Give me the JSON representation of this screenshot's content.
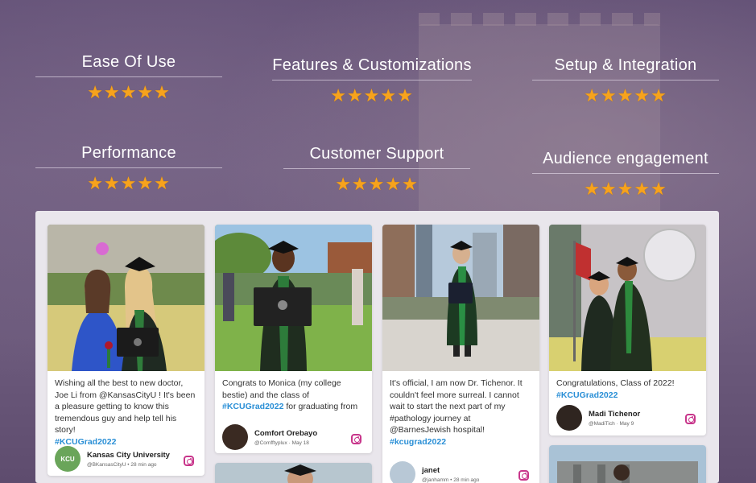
{
  "ratings": [
    {
      "title": "Ease Of Use",
      "stars": "★★★★★"
    },
    {
      "title": "Features & Customizations",
      "stars": "★★★★★"
    },
    {
      "title": "Setup & Integration",
      "stars": "★★★★★"
    },
    {
      "title": "Performance",
      "stars": "★★★★★"
    },
    {
      "title": "Customer Support",
      "stars": "★★★★★"
    },
    {
      "title": "Audience engagement",
      "stars": "★★★★★"
    }
  ],
  "colors": {
    "star": "#f7a31c",
    "hashtag": "#2a8fd6",
    "instagram": "#c8368b"
  },
  "posts": [
    {
      "text": "Wishing all the best to new doctor, Joe Li from @KansasCityU ! It's been a pleasure getting to know this tremendous guy and help tell his story!",
      "hashtag": "#KCUGrad2022",
      "author": "Kansas City University",
      "meta": "@BKansasCityU • 28 min ago",
      "avatar_text": "KCU",
      "icon": "instagram-icon"
    },
    {
      "text": "Congrats to Monica (my college bestie) and the class of",
      "hashtag": "#KCUGrad2022",
      "text_after": " for graduating from",
      "author": "Comfort Orebayo",
      "meta": "@Comfftyplux · May 18",
      "icon": "instagram-icon"
    },
    {
      "text": "It's official, I am now Dr. Tichenor. It couldn't feel more surreal. I cannot wait to start the next part of my #pathology journey at @BarnesJewish hospital!",
      "hashtag": "#kcugrad2022",
      "author": "janet",
      "meta": "@janhamm • 28 min ago",
      "icon": "instagram-icon"
    },
    {
      "text": "Congratulations, Class of 2022!",
      "hashtag": "#KCUGrad2022",
      "author": "Madi Tichenor",
      "meta": "@MadiTich · May 9",
      "icon": "instagram-icon"
    }
  ]
}
